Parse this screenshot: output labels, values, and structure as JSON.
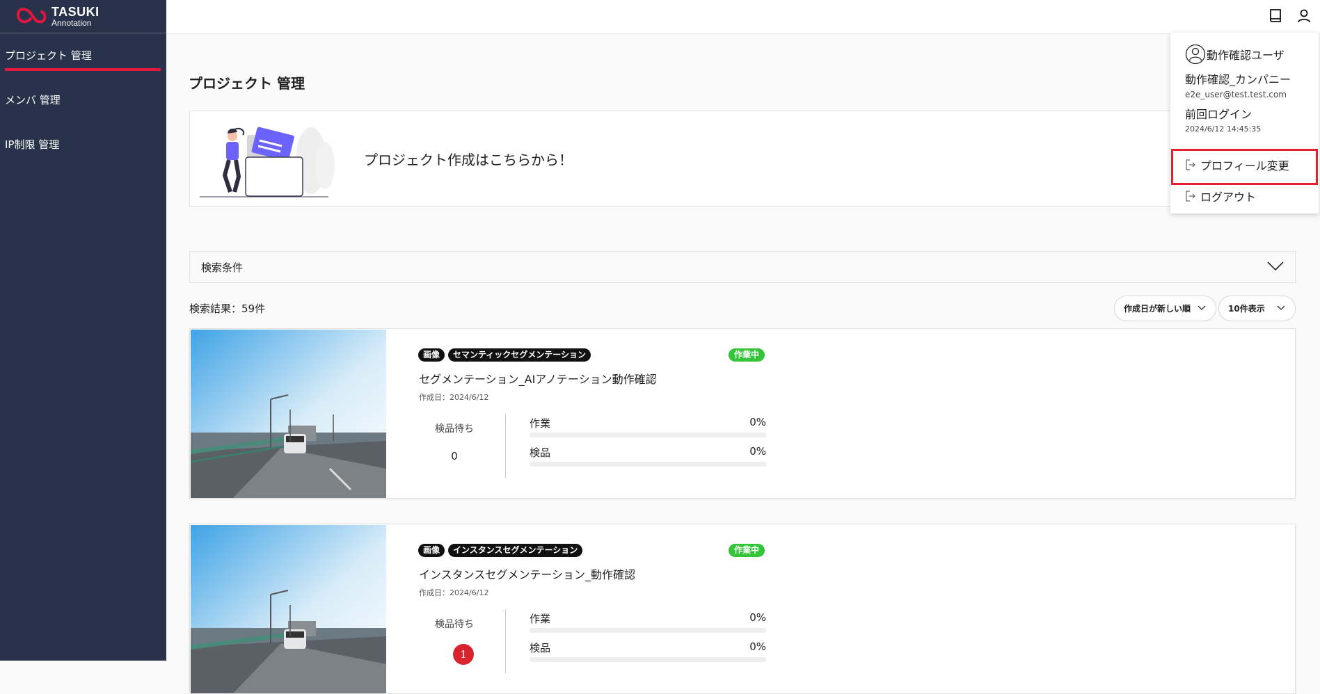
{
  "brand": {
    "name": "TASUKI",
    "sub": "Annotation"
  },
  "sidebar": {
    "items": [
      {
        "label": "プロジェクト 管理",
        "active": true
      },
      {
        "label": "メンバ 管理",
        "active": false
      },
      {
        "label": "IP制限 管理",
        "active": false
      }
    ]
  },
  "header": {
    "icons": [
      "book-icon",
      "user-icon"
    ]
  },
  "main": {
    "title": "プロジェクト 管理",
    "create_text": "プロジェクト作成はこちらから！",
    "search_label": "検索条件",
    "result_count": "検索結果：59件",
    "sort_select": "作成日が新しい順",
    "page_size_select": "10件表示"
  },
  "projects": [
    {
      "tags": [
        "画像",
        "セマンティックセグメンテーション"
      ],
      "status": "作業中",
      "title": "セグメンテーション_AIアノテーション動作確認",
      "date": "作成日：2024/6/12",
      "wait_label": "検品待ち",
      "wait_value": "0",
      "progress": [
        {
          "label": "作業",
          "percent": "0%",
          "value": 0
        },
        {
          "label": "検品",
          "percent": "0%",
          "value": 0
        }
      ]
    },
    {
      "tags": [
        "画像",
        "インスタンスセグメンテーション"
      ],
      "status": "作業中",
      "title": "インスタンスセグメンテーション_動作確認",
      "date": "作成日：2024/6/12",
      "wait_label": "検品待ち",
      "wait_value": "1",
      "progress": [
        {
          "label": "作業",
          "percent": "0%",
          "value": 0
        },
        {
          "label": "検品",
          "percent": "0%",
          "value": 0
        }
      ]
    }
  ],
  "user_menu": {
    "user_name": "動作確認ユーザ",
    "company": "動作確認_カンパニー",
    "email": "e2e_user@test.test.com",
    "last_login_label": "前回ログイン",
    "last_login_value": "2024/6/12 14:45:35",
    "profile_label": "プロフィール変更",
    "logout_label": "ログアウト"
  },
  "colors": {
    "sidebar": "#28324a",
    "accent": "#e3173d",
    "status": "#33c438",
    "highlight": "#e3202b"
  }
}
